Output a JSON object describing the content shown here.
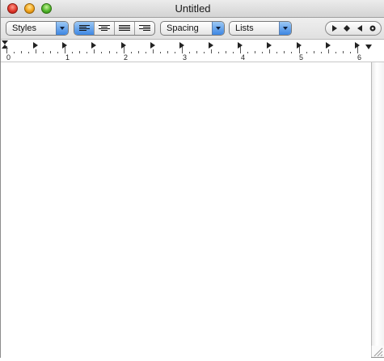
{
  "window": {
    "title": "Untitled"
  },
  "toolbar": {
    "styles": "Styles",
    "spacing": "Spacing",
    "lists": "Lists",
    "alignment": [
      "align-left",
      "align-center",
      "align-justify",
      "align-right"
    ],
    "alignment_selected": "align-left",
    "colors": {
      "accent": "#3d87e3"
    }
  },
  "ruler": {
    "inch_labels": [
      "0",
      "1",
      "2",
      "3",
      "4",
      "5",
      "6"
    ]
  }
}
